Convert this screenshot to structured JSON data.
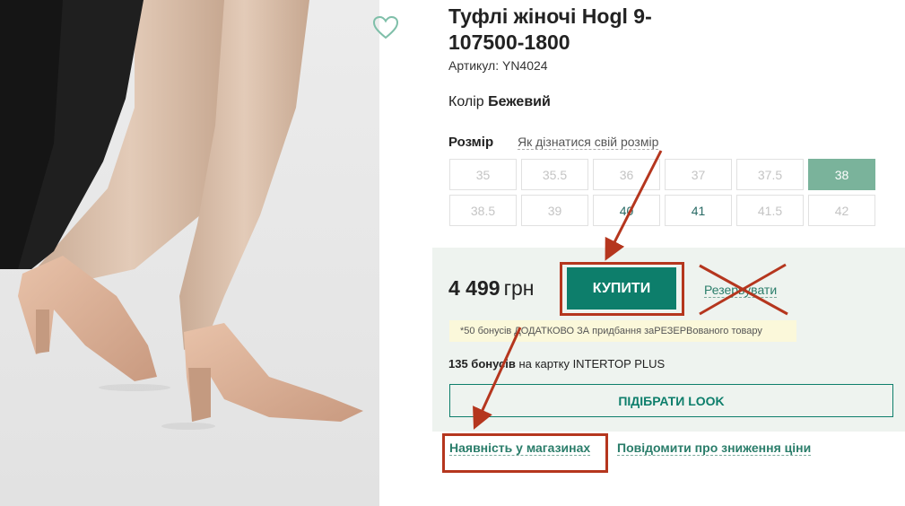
{
  "product": {
    "title": "Туфлі жіночі Hogl 9-107500-1800",
    "sku_label": "Артикул:",
    "sku_value": "YN4024",
    "color_label": "Колір",
    "color_value": "Бежевий"
  },
  "photo": {
    "alt_icon": "shoe-photo"
  },
  "favorite": {
    "icon": "heart-outline-icon"
  },
  "size": {
    "label": "Розмір",
    "help_link": "Як дізнатися свій розмір",
    "options": [
      {
        "value": "35",
        "state": "unavailable"
      },
      {
        "value": "35.5",
        "state": "unavailable"
      },
      {
        "value": "36",
        "state": "unavailable"
      },
      {
        "value": "37",
        "state": "unavailable"
      },
      {
        "value": "37.5",
        "state": "unavailable"
      },
      {
        "value": "38",
        "state": "selected"
      },
      {
        "value": "38.5",
        "state": "unavailable"
      },
      {
        "value": "39",
        "state": "unavailable"
      },
      {
        "value": "40",
        "state": "available"
      },
      {
        "value": "41",
        "state": "available"
      },
      {
        "value": "41.5",
        "state": "unavailable"
      },
      {
        "value": "42",
        "state": "unavailable"
      }
    ]
  },
  "buy": {
    "price_value": "4 499",
    "price_currency": "грн",
    "buy_label": "КУПИТИ",
    "reserve_label": "Резервувати",
    "bonus_note": "*50 бонусів ДОДАТКОВО ЗА придбання заРЕЗЕРВованого товару",
    "bonus_amount": "135 бонусів",
    "bonus_rest": "на картку INTERTOP PLUS",
    "look_label": "ПІДІБРАТИ LOOK"
  },
  "links": {
    "stores": "Наявність у магазинах",
    "notify": "Повідомити про зниження ціни"
  },
  "colors": {
    "accent": "#0d7e6b",
    "selected_size": "#7ab39b",
    "annotation": "#b5361e",
    "buybox_bg": "#eef3ef"
  }
}
